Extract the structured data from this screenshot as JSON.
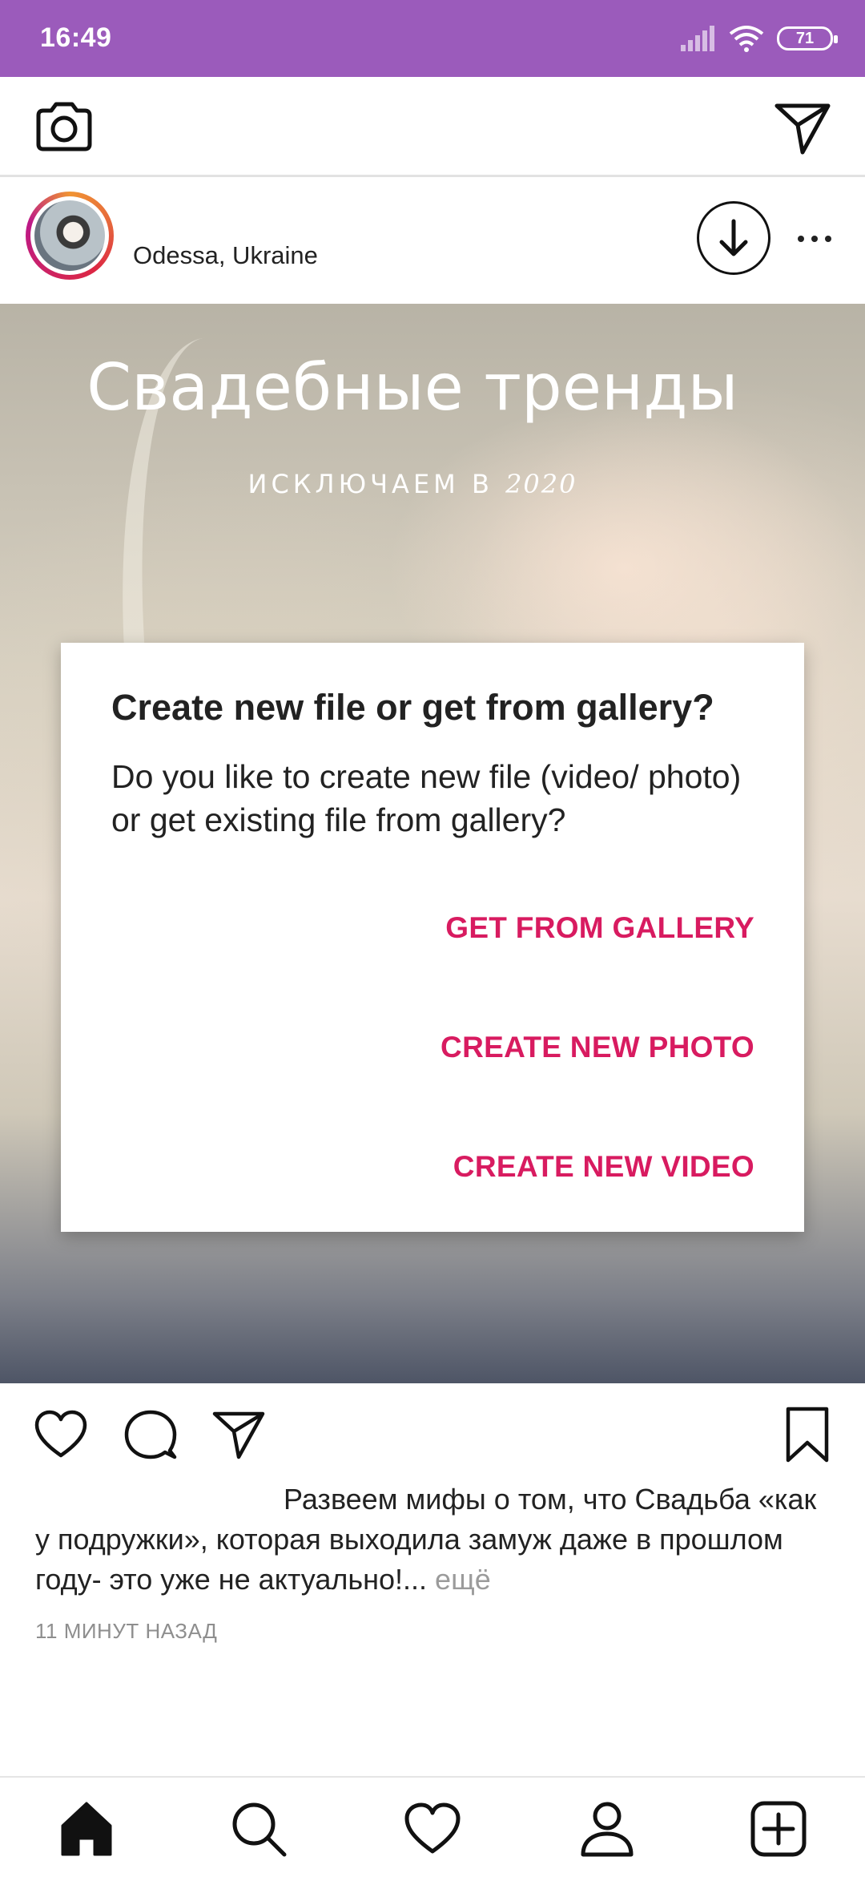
{
  "status_bar": {
    "time": "16:49",
    "battery": "71"
  },
  "post": {
    "location": "Odessa, Ukraine",
    "image_title": "Свадебные тренды",
    "image_subtitle_main": "ИСКЛЮЧАЕМ В ",
    "image_subtitle_year": "2020",
    "caption": "Развеем мифы о том, что Свадьба «как у подружки», которая выходила замуж даже в прошлом году- это уже не актуально!...",
    "caption_more": "ещё",
    "timestamp": "11 МИНУТ НАЗАД"
  },
  "dialog": {
    "title": "Create new file or get from gallery?",
    "message": "Do you like to create new file (video/ photo) or get existing file from gallery?",
    "buttons": {
      "gallery": "GET FROM GALLERY",
      "photo": "CREATE NEW PHOTO",
      "video": "CREATE NEW VIDEO"
    }
  },
  "colors": {
    "status_bar": "#9b5bbb",
    "accent": "#d81b60"
  },
  "icons": {
    "header": [
      "camera-icon",
      "paper-plane-icon"
    ],
    "post": [
      "download-icon",
      "more-icon"
    ],
    "actions": [
      "heart-icon",
      "comment-icon",
      "paper-plane-icon",
      "bookmark-icon"
    ],
    "nav": [
      "home-icon",
      "search-icon",
      "heart-icon",
      "profile-icon",
      "add-icon"
    ]
  }
}
